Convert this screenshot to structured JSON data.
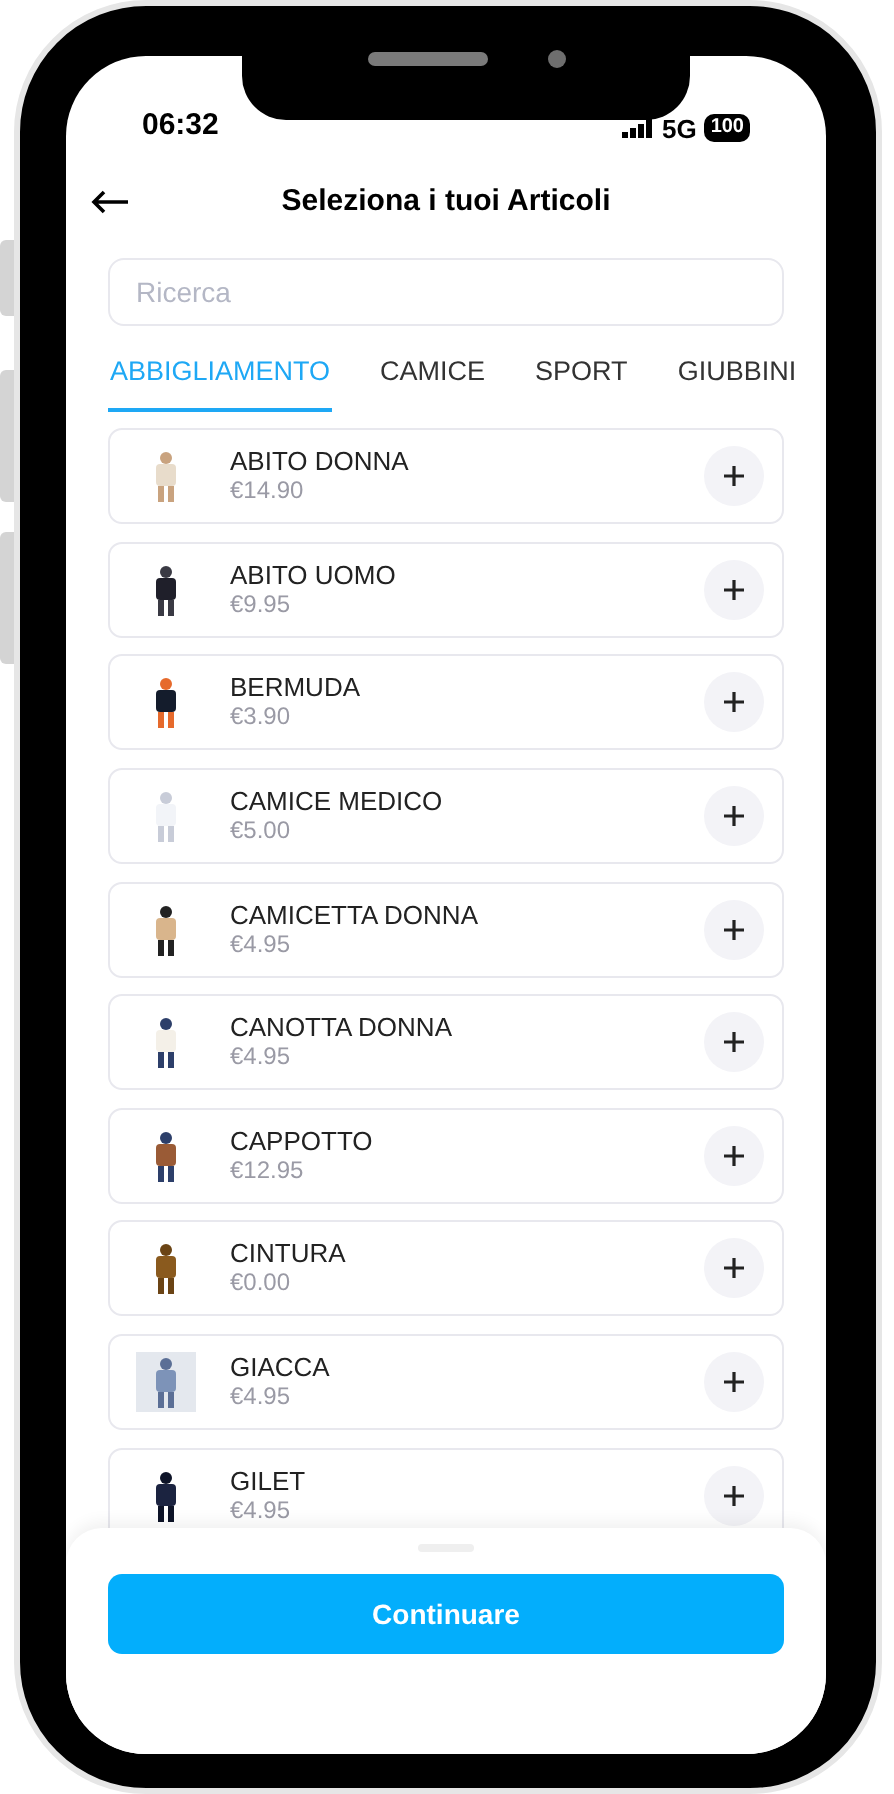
{
  "status_bar": {
    "time": "06:32",
    "network": "5G",
    "battery": "100"
  },
  "header": {
    "title": "Seleziona i tuoi Articoli"
  },
  "search": {
    "placeholder": "Ricerca"
  },
  "tabs": [
    {
      "label": "ABBIGLIAMENTO",
      "selected": true
    },
    {
      "label": "CAMICE",
      "selected": false
    },
    {
      "label": "SPORT",
      "selected": false
    },
    {
      "label": "GIUBBINI",
      "selected": false
    }
  ],
  "items": [
    {
      "name": "ABITO DONNA",
      "price": "€14.90"
    },
    {
      "name": "ABITO UOMO",
      "price": "€9.95"
    },
    {
      "name": "BERMUDA",
      "price": "€3.90"
    },
    {
      "name": "CAMICE MEDICO",
      "price": "€5.00"
    },
    {
      "name": "CAMICETTA DONNA",
      "price": "€4.95"
    },
    {
      "name": "CANOTTA DONNA",
      "price": "€4.95"
    },
    {
      "name": "CAPPOTTO",
      "price": "€12.95"
    },
    {
      "name": "CINTURA",
      "price": "€0.00"
    },
    {
      "name": "GIACCA",
      "price": "€4.95"
    },
    {
      "name": "GILET",
      "price": "€4.95"
    }
  ],
  "button": {
    "label": "Continuare"
  }
}
